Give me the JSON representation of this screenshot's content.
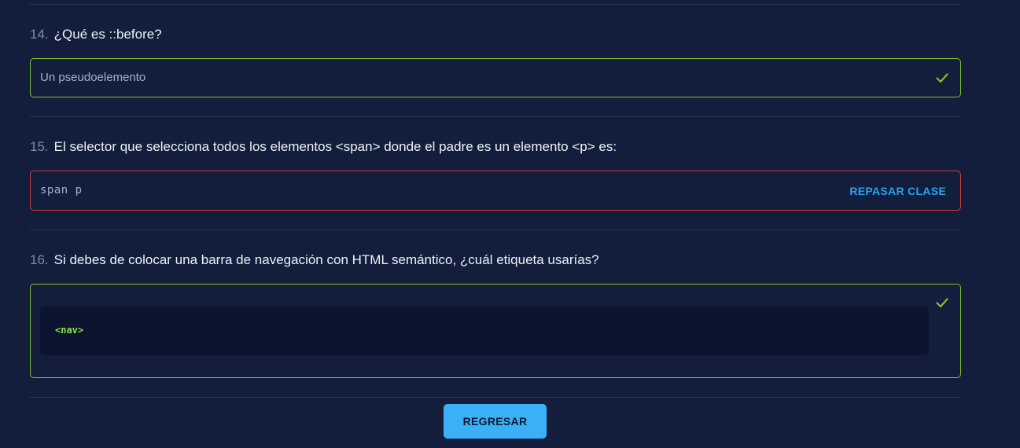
{
  "questions": [
    {
      "number": "14.",
      "text": "¿Qué es ::before?",
      "answer": "Un pseudoelemento",
      "status": "correct"
    },
    {
      "number": "15.",
      "text": "El selector que selecciona todos los elementos <span> donde el padre es un elemento <p> es:",
      "answer": "span p",
      "status": "incorrect",
      "review_label": "REPASAR CLASE"
    },
    {
      "number": "16.",
      "text": "Si debes de colocar una barra de navegación con HTML semántico, ¿cuál etiqueta usarías?",
      "answer": "<nav>",
      "status": "correct"
    }
  ],
  "back_button_label": "REGRESAR",
  "colors": {
    "background": "#121e3b",
    "correct": "#84c32a",
    "incorrect": "#d93a3a",
    "link": "#2aa0f0",
    "button": "#3bb0f7"
  }
}
